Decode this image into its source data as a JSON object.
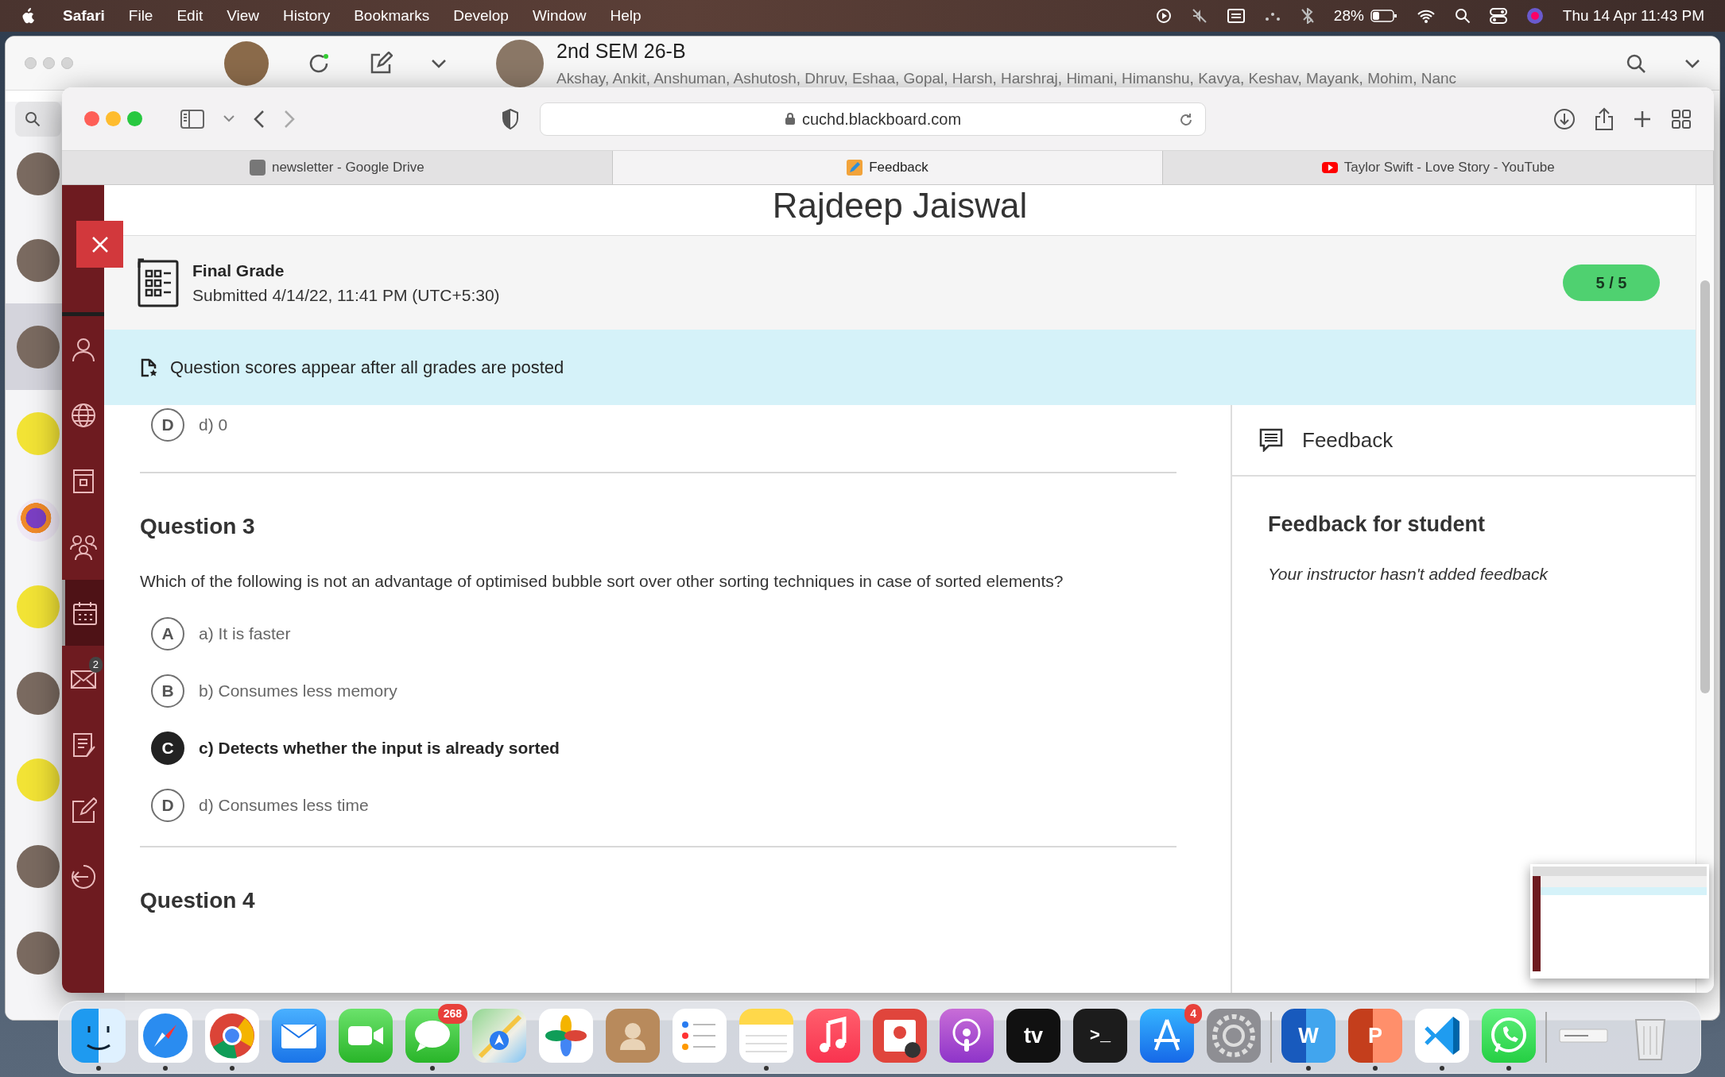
{
  "menu_bar": {
    "app_name": "Safari",
    "menus": [
      "File",
      "Edit",
      "View",
      "History",
      "Bookmarks",
      "Develop",
      "Window",
      "Help"
    ],
    "battery": "28%",
    "clock": "Thu 14 Apr  11:43 PM"
  },
  "chat_window": {
    "title": "2nd SEM 26-B",
    "members": "Akshay, Ankit, Anshuman, Ashutosh, Dhruv, Eshaa, Gopal, Harsh, Harshraj, Himani, Himanshu, Kavya, Keshav, Mayank, Mohim, Nanc",
    "chats": [
      {
        "kind": "photo",
        "selected": false
      },
      {
        "kind": "photo",
        "selected": false
      },
      {
        "kind": "photo",
        "selected": true
      },
      {
        "kind": "logo",
        "selected": false
      },
      {
        "kind": "gear-logo",
        "selected": false
      },
      {
        "kind": "logo",
        "selected": false
      },
      {
        "kind": "photo",
        "selected": false
      },
      {
        "kind": "logo",
        "selected": false
      },
      {
        "kind": "photo",
        "selected": false
      },
      {
        "kind": "photo",
        "selected": false
      }
    ]
  },
  "browser": {
    "url": "cuchd.blackboard.com",
    "tabs": [
      {
        "label": "newsletter - Google Drive",
        "kind": "drive",
        "selected": false
      },
      {
        "label": "Feedback",
        "kind": "pencil",
        "selected": true
      },
      {
        "label": "Taylor Swift - Love Story - YouTube",
        "kind": "video",
        "selected": false
      }
    ]
  },
  "course_nav": {
    "items": [
      {
        "kind": "person",
        "selected": false
      },
      {
        "kind": "globe",
        "selected": false
      },
      {
        "kind": "book",
        "selected": false
      },
      {
        "kind": "group",
        "selected": false
      },
      {
        "kind": "calendar",
        "selected": true
      },
      {
        "kind": "mail",
        "selected": false,
        "badge": "2"
      },
      {
        "kind": "grades",
        "selected": false
      },
      {
        "kind": "edit",
        "selected": false
      },
      {
        "kind": "logout",
        "selected": false
      }
    ]
  },
  "page": {
    "student_name": "Rajdeep Jaiswal",
    "grade": {
      "label": "Final Grade",
      "submitted": "Submitted 4/14/22, 11:41 PM (UTC+5:30)",
      "score": "5 / 5"
    },
    "notice": "Question scores appear after all grades are posted",
    "questions": [
      {
        "options": [
          {
            "letter": "D",
            "text": "d) 0",
            "selected": false
          }
        ]
      },
      {
        "title": "Question 3",
        "text": "Which of the following is not an advantage of optimised bubble sort over other sorting techniques in case of sorted elements?",
        "options": [
          {
            "letter": "A",
            "text": "a) It is faster",
            "selected": false
          },
          {
            "letter": "B",
            "text": "b) Consumes less memory",
            "selected": false
          },
          {
            "letter": "C",
            "text": "c) Detects whether the input is already sorted",
            "selected": true
          },
          {
            "letter": "D",
            "text": "d) Consumes less time",
            "selected": false
          }
        ]
      },
      {
        "title": "Question 4"
      }
    ],
    "feedback": {
      "header": "Feedback",
      "title": "Feedback for student",
      "text": "Your instructor hasn't added feedback"
    }
  },
  "dock": {
    "groups": [
      [
        {
          "kind": "finder",
          "running": true
        },
        {
          "kind": "safari",
          "running": true
        },
        {
          "kind": "chrome",
          "running": true
        },
        {
          "kind": "mail",
          "running": false
        },
        {
          "kind": "facetime",
          "running": false
        },
        {
          "kind": "messages",
          "running": true,
          "badge": "268"
        },
        {
          "kind": "maps",
          "running": false
        },
        {
          "kind": "photos",
          "running": false
        },
        {
          "kind": "contacts",
          "running": false
        },
        {
          "kind": "reminders",
          "running": false
        },
        {
          "kind": "notes",
          "running": true
        },
        {
          "kind": "music",
          "running": false
        },
        {
          "kind": "photobooth",
          "running": false
        },
        {
          "kind": "podcasts",
          "running": false
        },
        {
          "kind": "tv",
          "running": false,
          "glyph": "tv"
        },
        {
          "kind": "terminal",
          "running": false,
          "glyph": ">_"
        },
        {
          "kind": "appstore",
          "running": false,
          "badge": "4"
        },
        {
          "kind": "settings",
          "running": false
        }
      ],
      [
        {
          "kind": "word",
          "running": true,
          "glyph": "W"
        },
        {
          "kind": "powerpoint",
          "running": true,
          "glyph": "P"
        },
        {
          "kind": "vscode",
          "running": true
        },
        {
          "kind": "whatsapp",
          "running": true
        }
      ],
      [
        {
          "kind": "window",
          "running": false
        },
        {
          "kind": "trash",
          "running": false
        }
      ]
    ]
  }
}
